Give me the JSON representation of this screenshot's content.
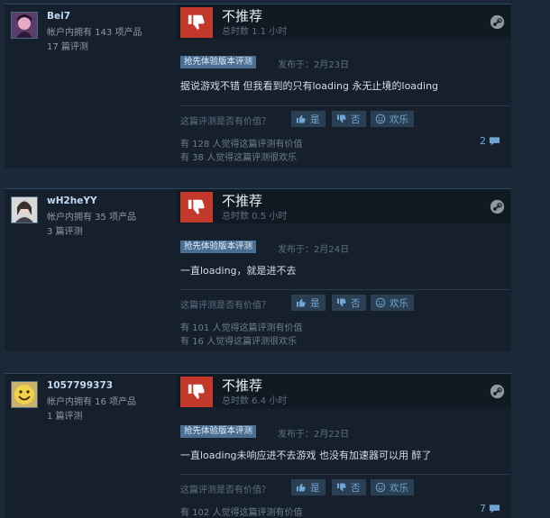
{
  "ui": {
    "helpful_question": "这篇评测是否有价值？",
    "btn_yes": "是",
    "btn_no": "否",
    "btn_funny": "欢乐"
  },
  "reviews": [
    {
      "author": "Bei7",
      "products": "帐户内拥有 143 项产品",
      "review_count": "17 篇评测",
      "verdict": "不推荐",
      "hours": "总时数 1.1 小时",
      "badge": "抢先体验版本评测",
      "posted": "发布于：2月23日",
      "text": "据说游戏不错 但我看到的只有loading 永无止境的loading",
      "helpful_count": "有 128 人觉得这篇评测有价值",
      "funny_count": "有 38 人觉得这篇评测很欢乐",
      "comments": "2"
    },
    {
      "author": "wH2heYY",
      "products": "帐户内拥有 35 项产品",
      "review_count": "3 篇评测",
      "verdict": "不推荐",
      "hours": "总时数 0.5 小时",
      "badge": "抢先体验版本评测",
      "posted": "发布于：2月24日",
      "text": "一直loading，就是进不去",
      "helpful_count": "有 101 人觉得这篇评测有价值",
      "funny_count": "有 16 人觉得这篇评测很欢乐",
      "comments": ""
    },
    {
      "author": "1057799373",
      "products": "帐户内拥有 16 项产品",
      "review_count": "1 篇评测",
      "verdict": "不推荐",
      "hours": "总时数 6.4 小时",
      "badge": "抢先体验版本评测",
      "posted": "发布于：2月22日",
      "text": "一直loading未响应进不去游戏 也没有加速器可以用 醉了",
      "helpful_count": "有 102 人觉得这篇评测有价值",
      "funny_count": "",
      "comments": "7"
    }
  ]
}
